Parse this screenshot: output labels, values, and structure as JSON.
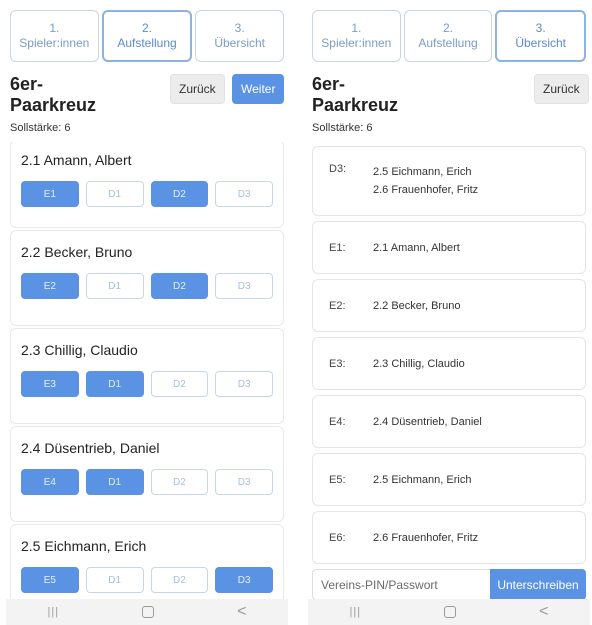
{
  "steps": [
    {
      "num": "1.",
      "label": "Spieler:innen"
    },
    {
      "num": "2.",
      "label": "Aufstellung"
    },
    {
      "num": "3.",
      "label": "Übersicht"
    }
  ],
  "left": {
    "title": "6er-Paarkreuz",
    "subtitle": "Sollstärke: 6",
    "back_label": "Zurück",
    "next_label": "Weiter",
    "players": [
      {
        "name": "2.1 Amann, Albert",
        "positions": [
          {
            "label": "E1",
            "selected": true
          },
          {
            "label": "D1",
            "selected": false
          },
          {
            "label": "D2",
            "selected": true
          },
          {
            "label": "D3",
            "selected": false
          }
        ]
      },
      {
        "name": "2.2 Becker, Bruno",
        "positions": [
          {
            "label": "E2",
            "selected": true
          },
          {
            "label": "D1",
            "selected": false
          },
          {
            "label": "D2",
            "selected": true
          },
          {
            "label": "D3",
            "selected": false
          }
        ]
      },
      {
        "name": "2.3 Chillig, Claudio",
        "positions": [
          {
            "label": "E3",
            "selected": true
          },
          {
            "label": "D1",
            "selected": true
          },
          {
            "label": "D2",
            "selected": false
          },
          {
            "label": "D3",
            "selected": false
          }
        ]
      },
      {
        "name": "2.4 Düsentrieb, Daniel",
        "positions": [
          {
            "label": "E4",
            "selected": true
          },
          {
            "label": "D1",
            "selected": true
          },
          {
            "label": "D2",
            "selected": false
          },
          {
            "label": "D3",
            "selected": false
          }
        ]
      },
      {
        "name": "2.5 Eichmann, Erich",
        "positions": [
          {
            "label": "E5",
            "selected": true
          },
          {
            "label": "D1",
            "selected": false
          },
          {
            "label": "D2",
            "selected": false
          },
          {
            "label": "D3",
            "selected": true
          }
        ]
      }
    ]
  },
  "right": {
    "title": "6er-Paarkreuz",
    "subtitle": "Sollstärke: 6",
    "back_label": "Zurück",
    "rows": [
      {
        "code": "D3:",
        "names": [
          "2.5 Eichmann, Erich",
          "2.6 Frauenhofer, Fritz"
        ]
      },
      {
        "code": "E1:",
        "names": [
          "2.1 Amann, Albert"
        ]
      },
      {
        "code": "E2:",
        "names": [
          "2.2 Becker, Bruno"
        ]
      },
      {
        "code": "E3:",
        "names": [
          "2.3 Chillig, Claudio"
        ]
      },
      {
        "code": "E4:",
        "names": [
          "2.4 Düsentrieb, Daniel"
        ]
      },
      {
        "code": "E5:",
        "names": [
          "2.5 Eichmann, Erich"
        ]
      },
      {
        "code": "E6:",
        "names": [
          "2.6 Frauenhofer, Fritz"
        ]
      }
    ],
    "pin_placeholder": "Vereins-PIN/Passwort",
    "sign_label": "Unterschreiben"
  },
  "navbar": {
    "recents_glyph": "|||",
    "back_glyph": "<"
  },
  "colors": {
    "accent": "#5a93e4",
    "step_text": "#7a9cc6",
    "chip_border": "#c7d6ea"
  }
}
